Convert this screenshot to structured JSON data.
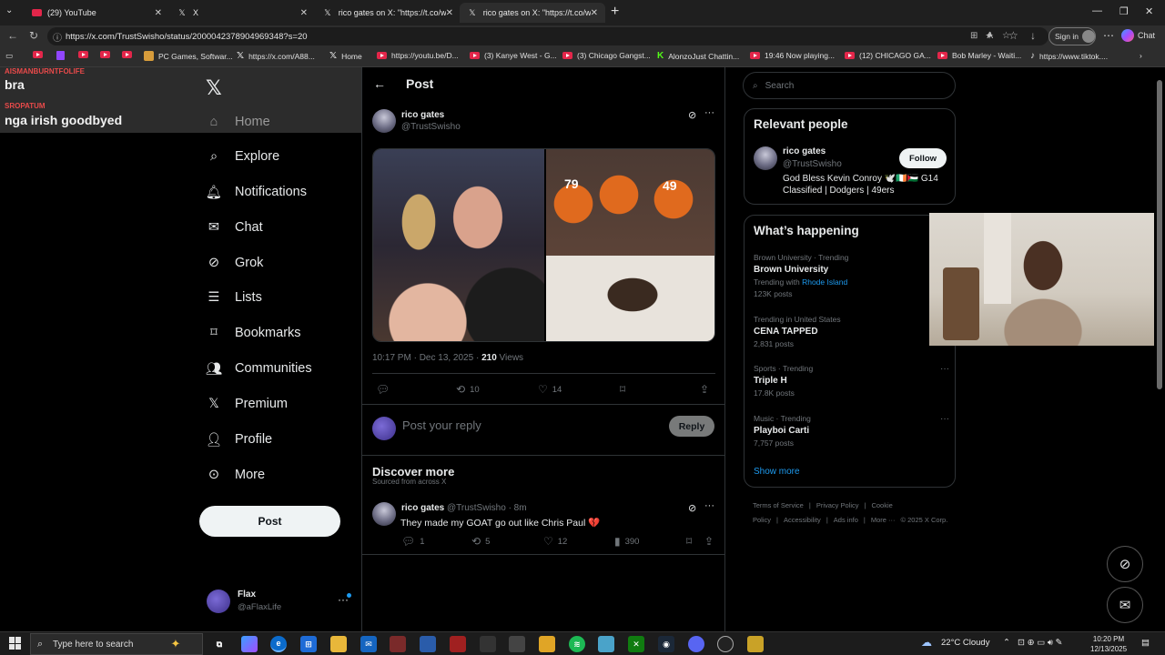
{
  "browser": {
    "tabs": [
      {
        "title": "(29) YouTube",
        "icon": "youtube-icon"
      },
      {
        "title": "X",
        "icon": "x-logo-icon"
      },
      {
        "title": "rico gates on X: \"https://t.co/wQls",
        "icon": "x-logo-icon"
      },
      {
        "title": "rico gates on X: \"https://t.co/wQls",
        "icon": "x-logo-icon"
      }
    ],
    "url": "https://x.com/TrustSwisho/status/2000042378904969348?s=20",
    "signin_label": "Sign in",
    "chat_label": "Chat",
    "bookmarks": [
      "PC Games, Softwar...",
      "https://x.com/A88...",
      "Home",
      "https://youtu.be/D...",
      "(3) Kanye West - G...",
      "(3) Chicago Gangst...",
      "AlonzoJust Chattin...",
      "19:46 Now playing...",
      "(12) CHICAGO GA...",
      "Bob Marley - Waiti...",
      "https://www.tiktok...."
    ]
  },
  "overlay": {
    "messages": [
      {
        "user": "AISMANBURNTFOLIFE",
        "text": "bra"
      },
      {
        "user": "SROPATUM",
        "text": "nga irish goodbyed"
      }
    ]
  },
  "nav": {
    "items": [
      {
        "label": "Home",
        "icon": "home-icon"
      },
      {
        "label": "Explore",
        "icon": "search-icon"
      },
      {
        "label": "Notifications",
        "icon": "bell-icon"
      },
      {
        "label": "Chat",
        "icon": "mail-icon"
      },
      {
        "label": "Grok",
        "icon": "grok-icon"
      },
      {
        "label": "Lists",
        "icon": "list-icon"
      },
      {
        "label": "Bookmarks",
        "icon": "bookmark-icon"
      },
      {
        "label": "Communities",
        "icon": "people-icon"
      },
      {
        "label": "Premium",
        "icon": "x-logo-icon"
      },
      {
        "label": "Profile",
        "icon": "person-icon"
      },
      {
        "label": "More",
        "icon": "more-circle-icon"
      }
    ],
    "post_label": "Post",
    "account": {
      "name": "Flax",
      "handle": "@aFlaxLife"
    }
  },
  "post": {
    "header_title": "Post",
    "author_name": "rico gates",
    "author_handle": "@TrustSwisho",
    "time": "10:17 PM · Dec 13, 2025 · ",
    "views_count": "210",
    "views_label": " Views",
    "stats": {
      "replies": "",
      "reposts": "10",
      "likes": "14"
    },
    "reply_placeholder": "Post your reply",
    "reply_button": "Reply",
    "jersey_numbers": [
      "79",
      "49"
    ]
  },
  "discover": {
    "title": "Discover more",
    "subtitle": "Sourced from across X",
    "tweet": {
      "name": "rico gates",
      "handle": "@TrustSwisho · 8m",
      "text": "They made my GOAT go out like Chris Paul ",
      "replies": "1",
      "reposts": "5",
      "likes": "12",
      "views": "390"
    }
  },
  "sidebar": {
    "search_placeholder": "Search",
    "relevant_title": "Relevant people",
    "person": {
      "name": "rico gates",
      "handle": "@TrustSwisho",
      "follow_label": "Follow",
      "bio": "God Bless Kevin Conroy 🕊️🇮🇪🇵🇸 G14 Classified | Dodgers | 49ers"
    },
    "happening_title": "What’s happening",
    "trends": [
      {
        "context": "Brown University · Trending",
        "name": "Brown University",
        "sub_prefix": "Trending with ",
        "sub_link": "Rhode Island",
        "posts": "123K posts"
      },
      {
        "context": "Trending in United States",
        "name": "CENA TAPPED",
        "posts": "2,831 posts"
      },
      {
        "context": "Sports · Trending",
        "name": "Triple H",
        "posts": "17.8K posts"
      },
      {
        "context": "Music · Trending",
        "name": "Playboi Carti",
        "posts": "7,757 posts"
      }
    ],
    "show_more": "Show more",
    "footer": [
      "Terms of Service",
      "|",
      "Privacy Policy",
      "|",
      "Cookie Policy",
      "|",
      "Accessibility",
      "|",
      "Ads info",
      "|",
      "More ···",
      "© 2025 X Corp."
    ]
  },
  "taskbar": {
    "search_placeholder": "Type here to search",
    "weather": "22°C  Cloudy",
    "time": "10:20 PM",
    "date": "12/13/2025"
  },
  "colors": {
    "accent": "#1d9bf0",
    "background": "#000000",
    "border": "#2f3336",
    "muted_text": "#71767b",
    "overlay_user": "#e84a4a"
  }
}
